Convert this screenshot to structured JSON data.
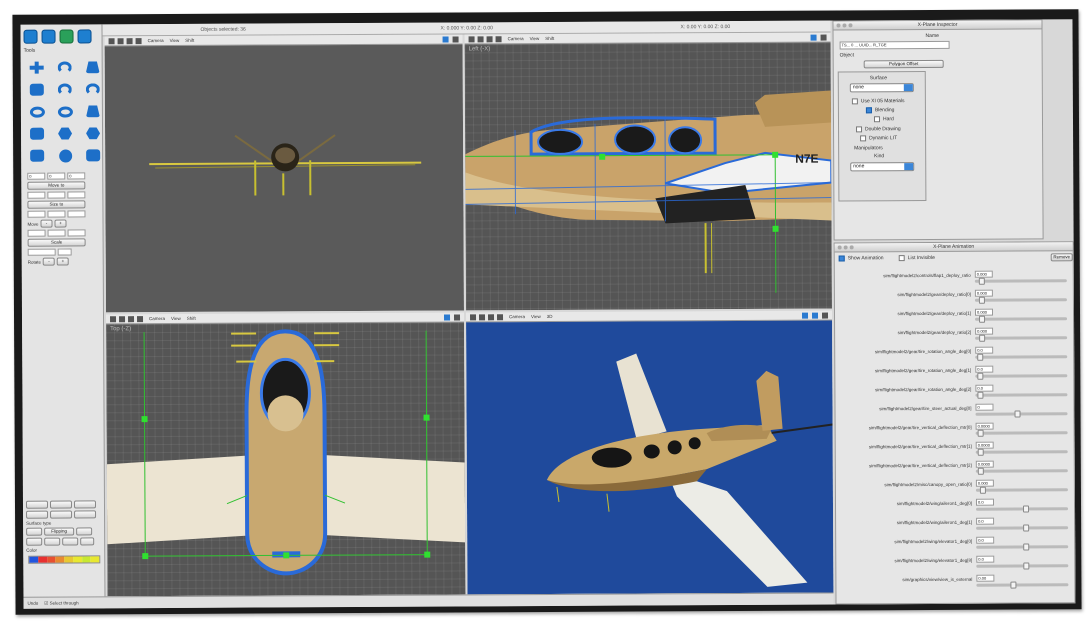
{
  "topbar": {
    "doc_status": "Objects selected: 36",
    "coord_left": "X: 0.000  Y: 0.00  Z: 0.00",
    "coord_right": "X: 0.00  Y: 0.00  Z: 0.00"
  },
  "palette": {
    "section_label": "Tools",
    "move_to_label": "Move to",
    "size_to_label": "Size to",
    "move_label": "Move",
    "scale_label": "Scale",
    "rotate_label": "Rotate",
    "coords_value": "0",
    "surface_type_label": "Surface type",
    "flipping_label": "Flipping",
    "color_label": "Color",
    "icons": [
      "move-icon",
      "rotate-icon",
      "extrude-icon",
      "box-icon",
      "cylinder-icon",
      "arc-icon",
      "ring-icon",
      "torus-icon",
      "wedge-icon",
      "plane-icon",
      "hexagon-icon",
      "cube-icon",
      "capsule-icon",
      "sphere-icon",
      "funnel-icon"
    ],
    "heatmap_colors": [
      "#2255dd",
      "#e83030",
      "#e85030",
      "#e88a30",
      "#e8c830",
      "#e8e830",
      "#c8e830",
      "#e8e830"
    ]
  },
  "viewports": {
    "menu": [
      "Camera",
      "View",
      "Shift"
    ],
    "left_label": "Left (-X)",
    "top_label": "Top (-Z)",
    "bottom_right_menu": [
      "Camera",
      "View",
      "3D"
    ],
    "livery": "N7E"
  },
  "plane_panel": {
    "title": "X-Plane Inspector",
    "name_label": "Name",
    "name_value": "TS... 0 ... UUID... R_TGE",
    "object_label": "Object",
    "polygon_offset_label": "Polygon Offset",
    "surface_label": "Surface",
    "surface_value": "none",
    "use_materials_label": "Use XI 05 Materials",
    "blending_label": "Blending",
    "hard_label": "Hard",
    "double_drawing_label": "Double Drawing",
    "dynamic_lit_label": "Dynamic LIT",
    "manipulators_label": "Manipulators",
    "kind_label": "Kind",
    "kind_value": "none"
  },
  "anim_panel": {
    "title": "X-Plane Animation",
    "show_animation_label": "Show Animation",
    "list_invisible_label": "List Invisible",
    "remove_label": "Remove",
    "rows": [
      {
        "label": "sim/flightmodel2/controls/flap1_deploy_ratio",
        "value": "0.000",
        "pos": 0.05
      },
      {
        "label": "sim/flightmodel2/gear/deploy_ratio[0]",
        "value": "0.000",
        "pos": 0.05
      },
      {
        "label": "sim/flightmodel2/gear/deploy_ratio[1]",
        "value": "0.000",
        "pos": 0.05
      },
      {
        "label": "sim/flightmodel2/gear/deploy_ratio[2]",
        "value": "0.000",
        "pos": 0.05
      },
      {
        "label": "sim/flightmodel2/gear/tire_rotation_angle_deg[0]",
        "value": "0.0",
        "pos": 0.02
      },
      {
        "label": "sim/flightmodel2/gear/tire_rotation_angle_deg[1]",
        "value": "0.0",
        "pos": 0.02
      },
      {
        "label": "sim/flightmodel2/gear/tire_rotation_angle_deg[2]",
        "value": "0.0",
        "pos": 0.02
      },
      {
        "label": "sim/flightmodel2/gear/tire_steer_actual_deg[0]",
        "value": "0",
        "pos": 0.45
      },
      {
        "label": "sim/flightmodel2/gear/tire_vertical_deflection_mtr[0]",
        "value": "0.0000",
        "pos": 0.02
      },
      {
        "label": "sim/flightmodel2/gear/tire_vertical_deflection_mtr[1]",
        "value": "0.0000",
        "pos": 0.02
      },
      {
        "label": "sim/flightmodel2/gear/tire_vertical_deflection_mtr[2]",
        "value": "0.0000",
        "pos": 0.02
      },
      {
        "label": "sim/flightmodel2/misc/canopy_open_ratio[0]",
        "value": "0.000",
        "pos": 0.05
      },
      {
        "label": "sim/flightmodel2/wing/aileron1_deg[0]",
        "value": "0.0",
        "pos": 0.55
      },
      {
        "label": "sim/flightmodel2/wing/aileron1_deg[1]",
        "value": "0.0",
        "pos": 0.55
      },
      {
        "label": "sim/flightmodel2/wing/elevator1_deg[0]",
        "value": "0.0",
        "pos": 0.55
      },
      {
        "label": "sim/flightmodel2/wing/elevator1_deg[8]",
        "value": "0.0",
        "pos": 0.55
      },
      {
        "label": "sim/graphics/view/view_is_external",
        "value": "0.00",
        "pos": 0.4
      }
    ]
  },
  "statusbar": {
    "left": "Undo",
    "select_through_label": "Select through"
  }
}
